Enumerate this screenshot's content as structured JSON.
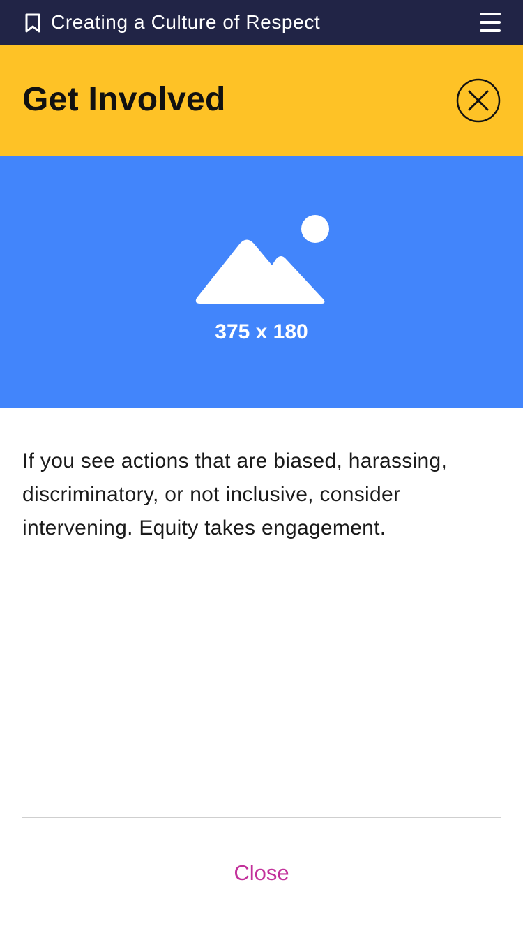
{
  "top_bar": {
    "title": "Creating a Culture of Respect",
    "bookmark_icon": "bookmark-icon",
    "menu_icon": "hamburger-menu-icon",
    "background_color": "#212446"
  },
  "header": {
    "title": "Get Involved",
    "close_icon": "close-circle-icon",
    "background_color": "#fec226"
  },
  "hero": {
    "placeholder_icon": "image-placeholder-icon",
    "dimensions_label": "375 x 180",
    "background_color": "#4285fb"
  },
  "content": {
    "body": "If you see actions that are biased, harassing, discriminatory, or not inclusive, consider intervening. Equity takes engagement."
  },
  "footer": {
    "close_label": "Close",
    "close_color": "#c2309a"
  }
}
